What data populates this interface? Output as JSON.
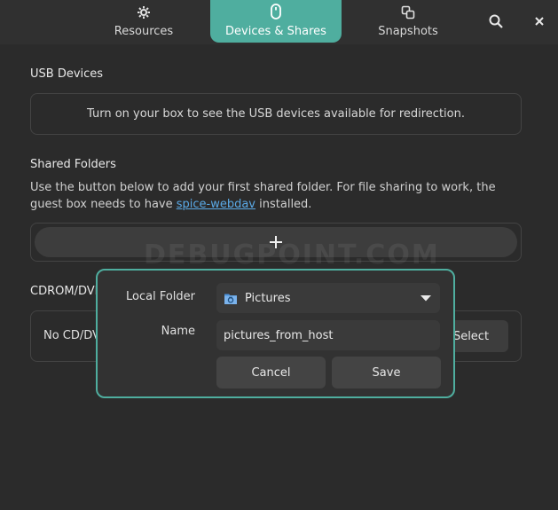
{
  "tabs": [
    {
      "label": "Resources",
      "icon": "gear-icon"
    },
    {
      "label": "Devices & Shares",
      "icon": "mouse-icon",
      "active": true
    },
    {
      "label": "Snapshots",
      "icon": "snapshots-icon"
    }
  ],
  "header": {
    "search_icon": "search-icon",
    "close_icon": "close-icon"
  },
  "usb": {
    "title": "USB Devices",
    "message": "Turn on your box to see the USB devices available for redirection."
  },
  "shared": {
    "title": "Shared Folders",
    "desc_before": "Use the button below to add your first shared folder. For file sharing to work, the guest box needs to have ",
    "desc_link": "spice-webdav",
    "desc_after": " installed."
  },
  "watermark": "DEBUGPOINT.COM",
  "cdrom": {
    "title": "CDROM/DVD",
    "label": "No CD/DVD",
    "select_label": "Select"
  },
  "dialog": {
    "local_folder_label": "Local Folder",
    "folder_value": "Pictures",
    "name_label": "Name",
    "name_value": "pictures_from_host",
    "cancel_label": "Cancel",
    "save_label": "Save"
  },
  "colors": {
    "accent": "#4fae9f",
    "link": "#5aa9e6",
    "background": "#2b2b2b"
  }
}
